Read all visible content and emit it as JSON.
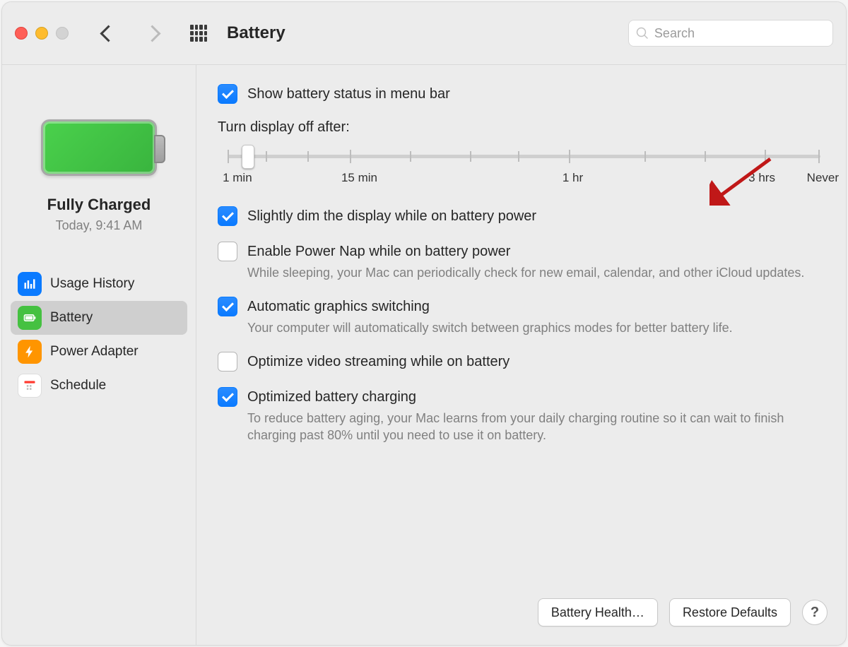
{
  "window": {
    "title": "Battery"
  },
  "search": {
    "placeholder": "Search"
  },
  "sidebar": {
    "status_title": "Fully Charged",
    "status_sub": "Today, 9:41 AM",
    "items": [
      {
        "label": "Usage History"
      },
      {
        "label": "Battery"
      },
      {
        "label": "Power Adapter"
      },
      {
        "label": "Schedule"
      }
    ],
    "selected_index": 1
  },
  "main": {
    "show_menu_bar": {
      "checked": true,
      "label": "Show battery status in menu bar"
    },
    "display_off": {
      "label": "Turn display off after:",
      "marks": [
        "1 min",
        "15 min",
        "1 hr",
        "3 hrs",
        "Never"
      ],
      "thumb_position_pct": 3
    },
    "options": [
      {
        "checked": true,
        "label": "Slightly dim the display while on battery power",
        "desc": ""
      },
      {
        "checked": false,
        "label": "Enable Power Nap while on battery power",
        "desc": "While sleeping, your Mac can periodically check for new email, calendar, and other iCloud updates."
      },
      {
        "checked": true,
        "label": "Automatic graphics switching",
        "desc": "Your computer will automatically switch between graphics modes for better battery life."
      },
      {
        "checked": false,
        "label": "Optimize video streaming while on battery",
        "desc": ""
      },
      {
        "checked": true,
        "label": "Optimized battery charging",
        "desc": "To reduce battery aging, your Mac learns from your daily charging routine so it can wait to finish charging past 80% until you need to use it on battery."
      }
    ]
  },
  "footer": {
    "battery_health": "Battery Health…",
    "restore_defaults": "Restore Defaults",
    "help": "?"
  }
}
